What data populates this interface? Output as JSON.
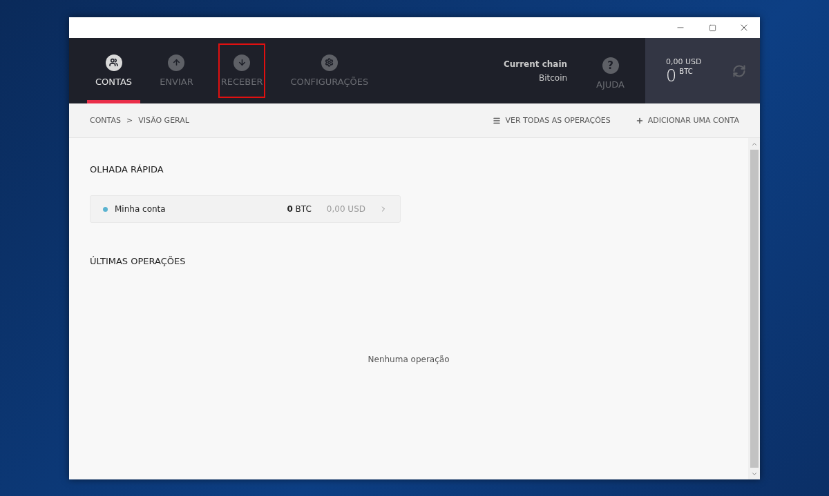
{
  "nav": {
    "tabs": [
      {
        "label": "CONTAS",
        "selected": true,
        "highlighted": false
      },
      {
        "label": "ENVIAR",
        "selected": false,
        "highlighted": false
      },
      {
        "label": "RECEBER",
        "selected": false,
        "highlighted": true
      },
      {
        "label": "CONFIGURAÇÕES",
        "selected": false,
        "highlighted": false
      }
    ],
    "chain": {
      "title": "Current chain",
      "value": "Bitcoin"
    },
    "help": {
      "label": "AJUDA",
      "icon": "?"
    },
    "balance": {
      "fiat": "0,00 USD",
      "amount": "0",
      "unit": "BTC"
    }
  },
  "breadcrumb": {
    "items": [
      "CONTAS",
      "VISÃO GERAL"
    ],
    "separator": ">"
  },
  "actions": [
    {
      "label": "VER TODAS AS OPERAÇÕES"
    },
    {
      "label": "ADICIONAR UMA CONTA"
    }
  ],
  "quick_look": {
    "title": "OLHADA RÁPIDA",
    "accounts": [
      {
        "name": "Minha conta",
        "color": "#5ab3d0",
        "balance": "**0** BTC",
        "fiat": "0,00 USD"
      }
    ]
  },
  "latest": {
    "title": "ÚLTIMAS OPERAÇÕES",
    "empty": "Nenhuma operação"
  }
}
